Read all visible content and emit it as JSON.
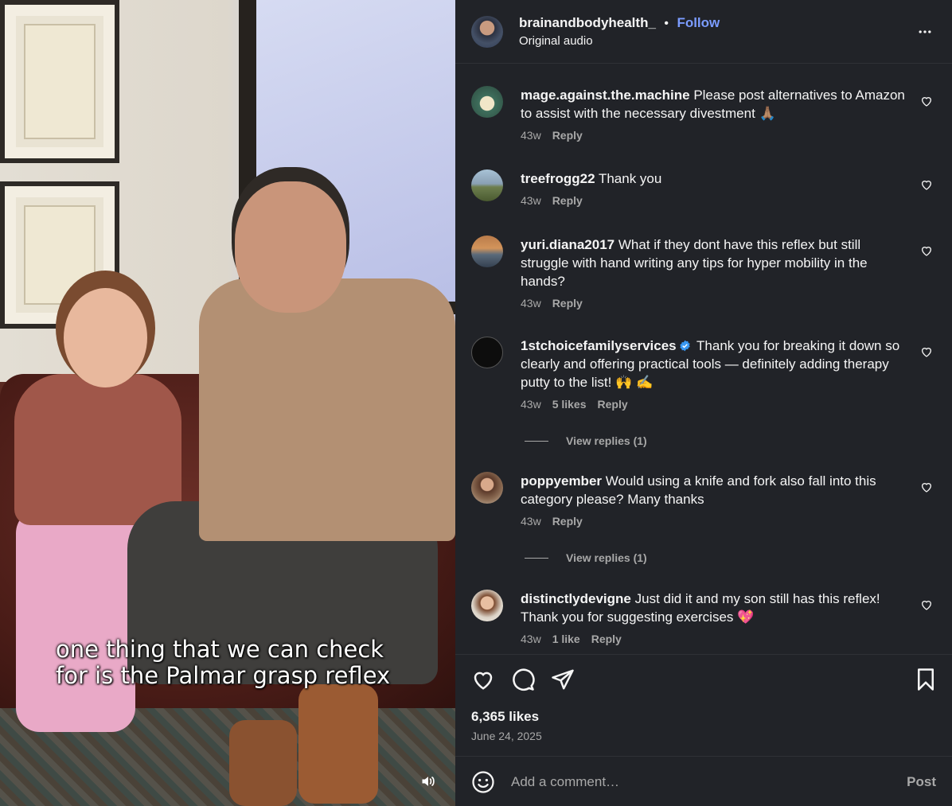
{
  "video": {
    "caption_line1": "one thing that we can check",
    "caption_line2": "for is the Palmar grasp reflex"
  },
  "header": {
    "username": "brainandbodyhealth_",
    "separator": "•",
    "follow_label": "Follow",
    "audio": "Original audio"
  },
  "comments": [
    {
      "user": "mage.against.the.machine",
      "text": "Please post alternatives to Amazon to assist with the necessary divestment 🙏🏽",
      "age": "43w",
      "likes": "",
      "reply": "Reply",
      "view_replies": ""
    },
    {
      "user": "treefrogg22",
      "text": "Thank you",
      "age": "43w",
      "likes": "",
      "reply": "Reply",
      "view_replies": ""
    },
    {
      "user": "yuri.diana2017",
      "text": "What if they dont have this reflex but still struggle with hand writing any tips for hyper mobility in the hands?",
      "age": "43w",
      "likes": "",
      "reply": "Reply",
      "view_replies": ""
    },
    {
      "user": "1stchoicefamilyservices",
      "text": "Thank you for breaking it down so clearly and offering practical tools — definitely adding therapy putty to the list! 🙌 ✍️",
      "age": "43w",
      "likes": "5 likes",
      "reply": "Reply",
      "view_replies": "View replies (1)",
      "verified": true
    },
    {
      "user": "poppyember",
      "text": "Would using a knife and fork also fall into this category please? Many thanks",
      "age": "43w",
      "likes": "",
      "reply": "Reply",
      "view_replies": "View replies (1)"
    },
    {
      "user": "distinctlydevigne",
      "text": "Just did it and my son still has this reflex! Thank you for suggesting exercises 💖",
      "age": "43w",
      "likes": "1 like",
      "reply": "Reply",
      "view_replies": ""
    }
  ],
  "footer": {
    "likes": "6,365 likes",
    "date": "June 24, 2025",
    "comment_placeholder": "Add a comment…",
    "post_label": "Post"
  },
  "icons": {
    "like": "heart-icon",
    "comment": "comment-bubble-icon",
    "share": "paper-plane-icon",
    "save": "bookmark-icon",
    "more": "more-options-icon",
    "emoji": "emoji-icon",
    "sound": "speaker-icon",
    "verified": "verified-badge-icon"
  },
  "colors": {
    "panel_bg": "#212328",
    "follow": "#7b9cff",
    "verified": "#3897f0"
  }
}
